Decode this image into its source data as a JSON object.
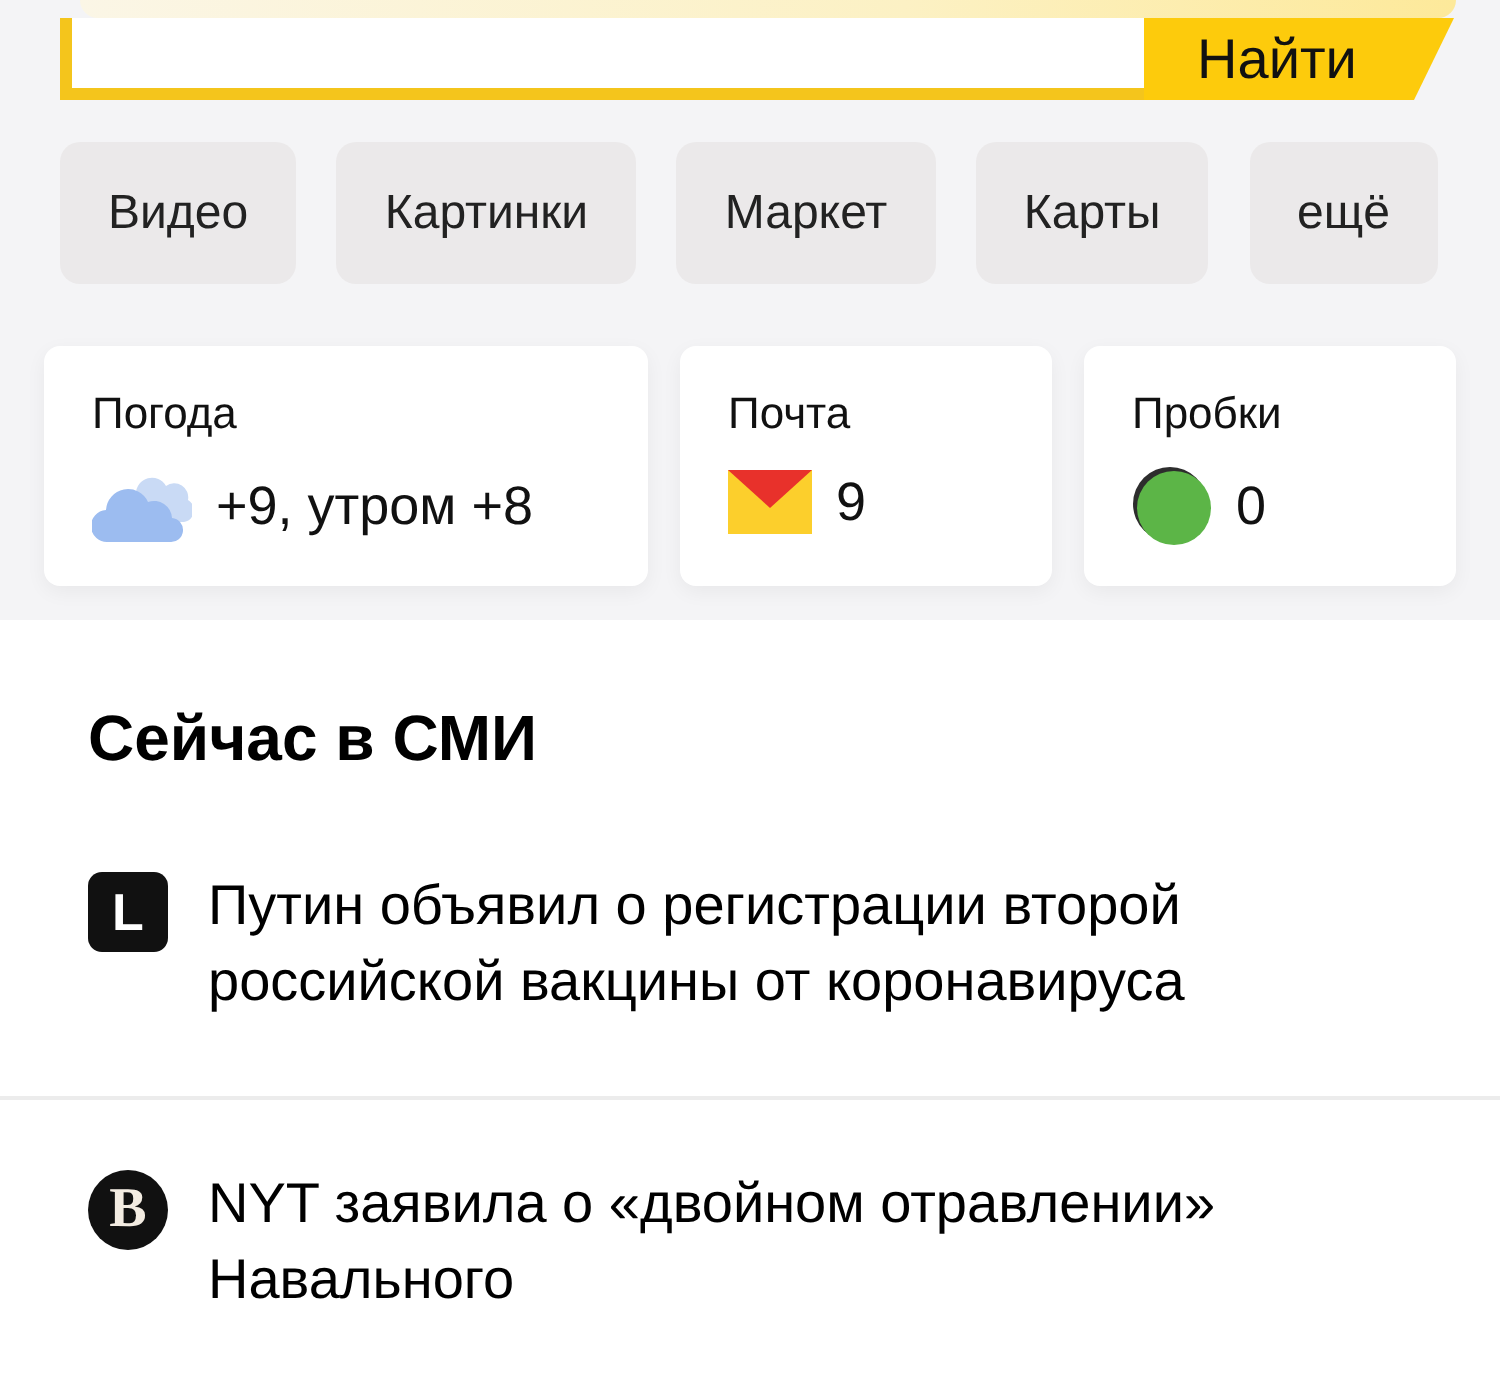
{
  "search": {
    "button": "Найти"
  },
  "services": [
    "Видео",
    "Картинки",
    "Маркет",
    "Карты",
    "ещё"
  ],
  "widgets": [
    {
      "kind": "weather",
      "title": "Погода",
      "value": "+9, утром +8"
    },
    {
      "kind": "mail",
      "title": "Почта",
      "value": "9"
    },
    {
      "kind": "traffic",
      "title": "Пробки",
      "value": "0"
    }
  ],
  "news": {
    "title": "Сейчас в СМИ",
    "items": [
      {
        "kind": "square",
        "logo": "L",
        "headline": "Путин объявил о регистрации второй российской вакцины от коронавируса"
      },
      {
        "kind": "circle",
        "logo": "B",
        "headline": "NYT заявила о «двойном отравлении» Навального"
      }
    ]
  }
}
